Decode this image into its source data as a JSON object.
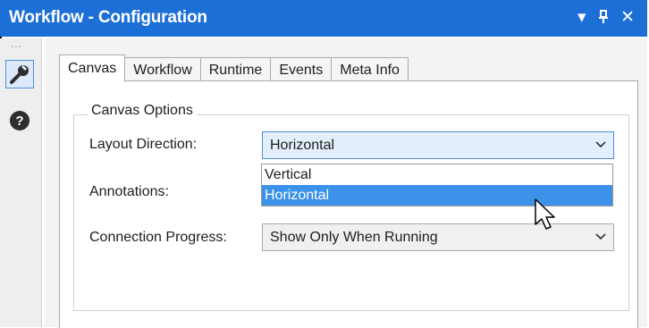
{
  "window": {
    "title": "Workflow - Configuration",
    "controls": {
      "dropdown": "▾",
      "pin": "𝟜",
      "close": "✕"
    }
  },
  "sidebar": {
    "grip": "⋯",
    "items": [
      {
        "icon": "wrench-icon",
        "selected": true
      },
      {
        "icon": "help-icon",
        "selected": false
      }
    ]
  },
  "tabs": [
    {
      "label": "Canvas",
      "active": true
    },
    {
      "label": "Workflow",
      "active": false
    },
    {
      "label": "Runtime",
      "active": false
    },
    {
      "label": "Events",
      "active": false
    },
    {
      "label": "Meta Info",
      "active": false
    }
  ],
  "canvas_options": {
    "group_title": "Canvas Options",
    "layout_direction": {
      "label": "Layout Direction:",
      "value": "Horizontal",
      "options": [
        "Vertical",
        "Horizontal"
      ],
      "highlighted": "Horizontal"
    },
    "annotations": {
      "label": "Annotations:"
    },
    "connection_progress": {
      "label": "Connection Progress:",
      "value": "Show Only When Running"
    }
  },
  "colors": {
    "title_bar": "#1c6fd6",
    "selection": "#3c92e8",
    "accent_border": "#4f8fdc"
  }
}
